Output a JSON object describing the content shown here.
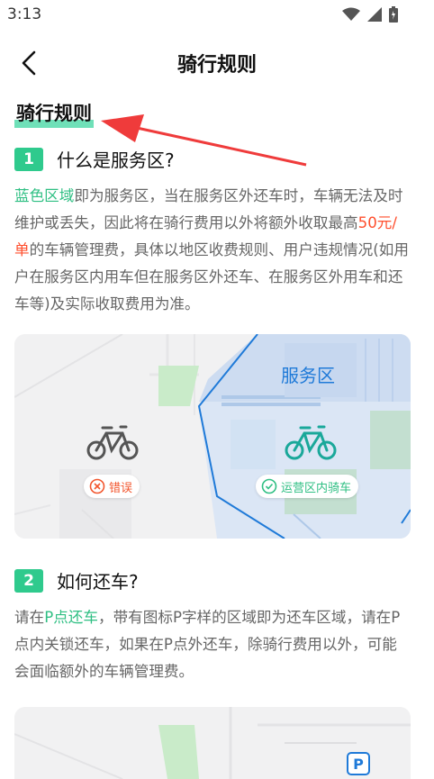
{
  "status_bar": {
    "time": "3:13"
  },
  "nav": {
    "title": "骑行规则"
  },
  "page": {
    "heading": "骑行规则"
  },
  "section1": {
    "number": "1",
    "title": "什么是服务区?",
    "highlight_blue_area": "蓝色区域",
    "text_a": "即为服务区，当在服务区外还车时，车辆无法及时维护或丢失，因此将在骑行费用以外将额外收取最高",
    "highlight_fee": "50元/单",
    "text_b": "的车辆管理费，具体以地区收费规则、用户违规情况(如用户在服务区内用车但在服务区外还车、在服务区外用车和还车等)及实际收取费用为准。",
    "map": {
      "service_area_label": "服务区",
      "error_tag": "错误",
      "ok_tag": "运营区内骑车"
    }
  },
  "section2": {
    "number": "2",
    "title": "如何还车?",
    "text_a": "请在",
    "highlight_p_point": "P点还车",
    "text_b": "，带有图标P字样的区域即为还车区域，请在P点内关锁还车，如果在P点外还车，除骑行费用以外，可能会面临额外的车辆管理费。",
    "map_parking_icon": "P"
  },
  "colors": {
    "accent_green": "#2fca8d",
    "fee_red": "#ff4f2e",
    "service_blue": "#1f7ad8",
    "arrow_red": "#ef3b3b"
  }
}
